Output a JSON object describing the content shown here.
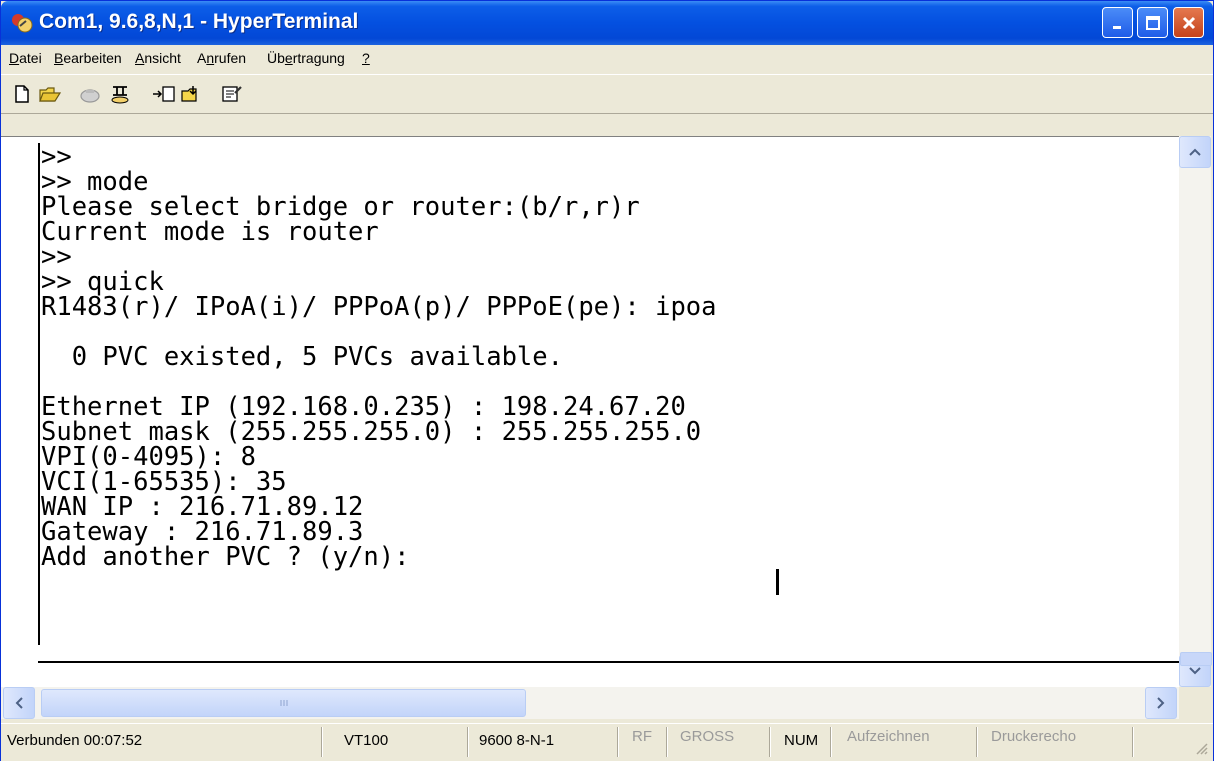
{
  "window": {
    "title": "Com1, 9.6,8,N,1 - HyperTerminal"
  },
  "menu": {
    "items": [
      {
        "pre": "",
        "key": "D",
        "post": "atei"
      },
      {
        "pre": "",
        "key": "B",
        "post": "earbeiten"
      },
      {
        "pre": "",
        "key": "A",
        "post": "nsicht"
      },
      {
        "pre": "A",
        "key": "n",
        "post": "rufen"
      },
      {
        "pre": "Üb",
        "key": "e",
        "post": "rtragung"
      },
      {
        "pre": "",
        "key": "?",
        "post": ""
      }
    ]
  },
  "toolbar": {
    "buttons": [
      "new-icon",
      "open-icon",
      "connect-icon",
      "disconnect-icon",
      "send-icon",
      "receive-icon",
      "properties-icon"
    ]
  },
  "terminal": {
    "lines": [
      ">>",
      ">> mode",
      "Please select bridge or router:(b/r,r)r",
      "Current mode is router",
      ">>",
      ">> quick",
      "R1483(r)/ IPoA(i)/ PPPoA(p)/ PPPoE(pe): ipoa",
      "",
      "  0 PVC existed, 5 PVCs available.",
      "",
      "Ethernet IP (192.168.0.235) : 198.24.67.20",
      "Subnet mask (255.255.255.0) : 255.255.255.0",
      "VPI(0-4095): 8",
      "VCI(1-65535): 35",
      "WAN IP : 216.71.89.12",
      "Gateway : 216.71.89.3",
      "Add another PVC ? (y/n):"
    ]
  },
  "statusbar": {
    "connected": "Verbunden 00:07:52",
    "emulation": "VT100",
    "port_settings": "9600 8-N-1",
    "rf": "RF",
    "gross": "GROSS",
    "num": "NUM",
    "capture": "Aufzeichnen",
    "print_echo": "Druckerecho"
  },
  "colors": {
    "titlebar": "#0450e0",
    "close_button": "#c4421b",
    "chrome": "#ece9d8"
  }
}
